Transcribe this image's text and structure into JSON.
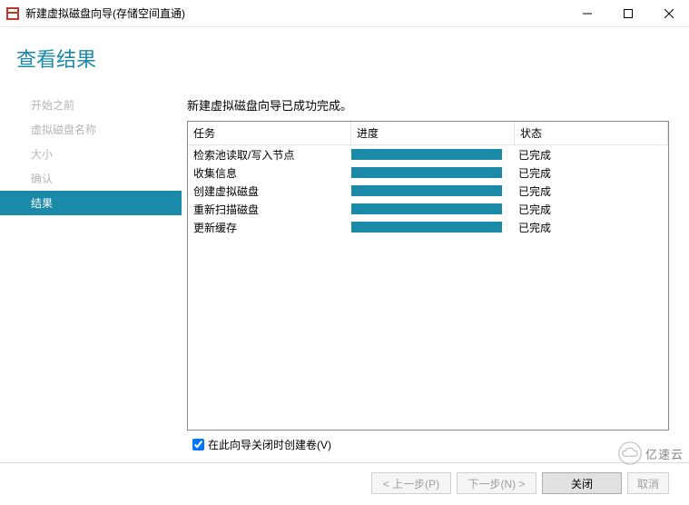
{
  "window_title": "新建虚拟磁盘向导(存储空间直通)",
  "page_title": "查看结果",
  "sidebar": {
    "items": [
      {
        "label": "开始之前"
      },
      {
        "label": "虚拟磁盘名称"
      },
      {
        "label": "大小"
      },
      {
        "label": "确认"
      },
      {
        "label": "结果"
      }
    ],
    "active_index": 4
  },
  "main": {
    "heading": "新建虚拟磁盘向导已成功完成。",
    "columns": {
      "task": "任务",
      "progress": "进度",
      "status": "状态"
    },
    "rows": [
      {
        "task": "检索池读取/写入节点",
        "status": "已完成"
      },
      {
        "task": "收集信息",
        "status": "已完成"
      },
      {
        "task": "创建虚拟磁盘",
        "status": "已完成"
      },
      {
        "task": "重新扫描磁盘",
        "status": "已完成"
      },
      {
        "task": "更新缓存",
        "status": "已完成"
      }
    ]
  },
  "checkbox_label": "在此向导关闭时创建卷(V)",
  "checkbox_checked": true,
  "buttons": {
    "prev": "< 上一步(P)",
    "next": "下一步(N) >",
    "close": "关闭",
    "cancel": "取消"
  },
  "watermark": "亿速云",
  "colors": {
    "accent": "#1a8aa8"
  }
}
